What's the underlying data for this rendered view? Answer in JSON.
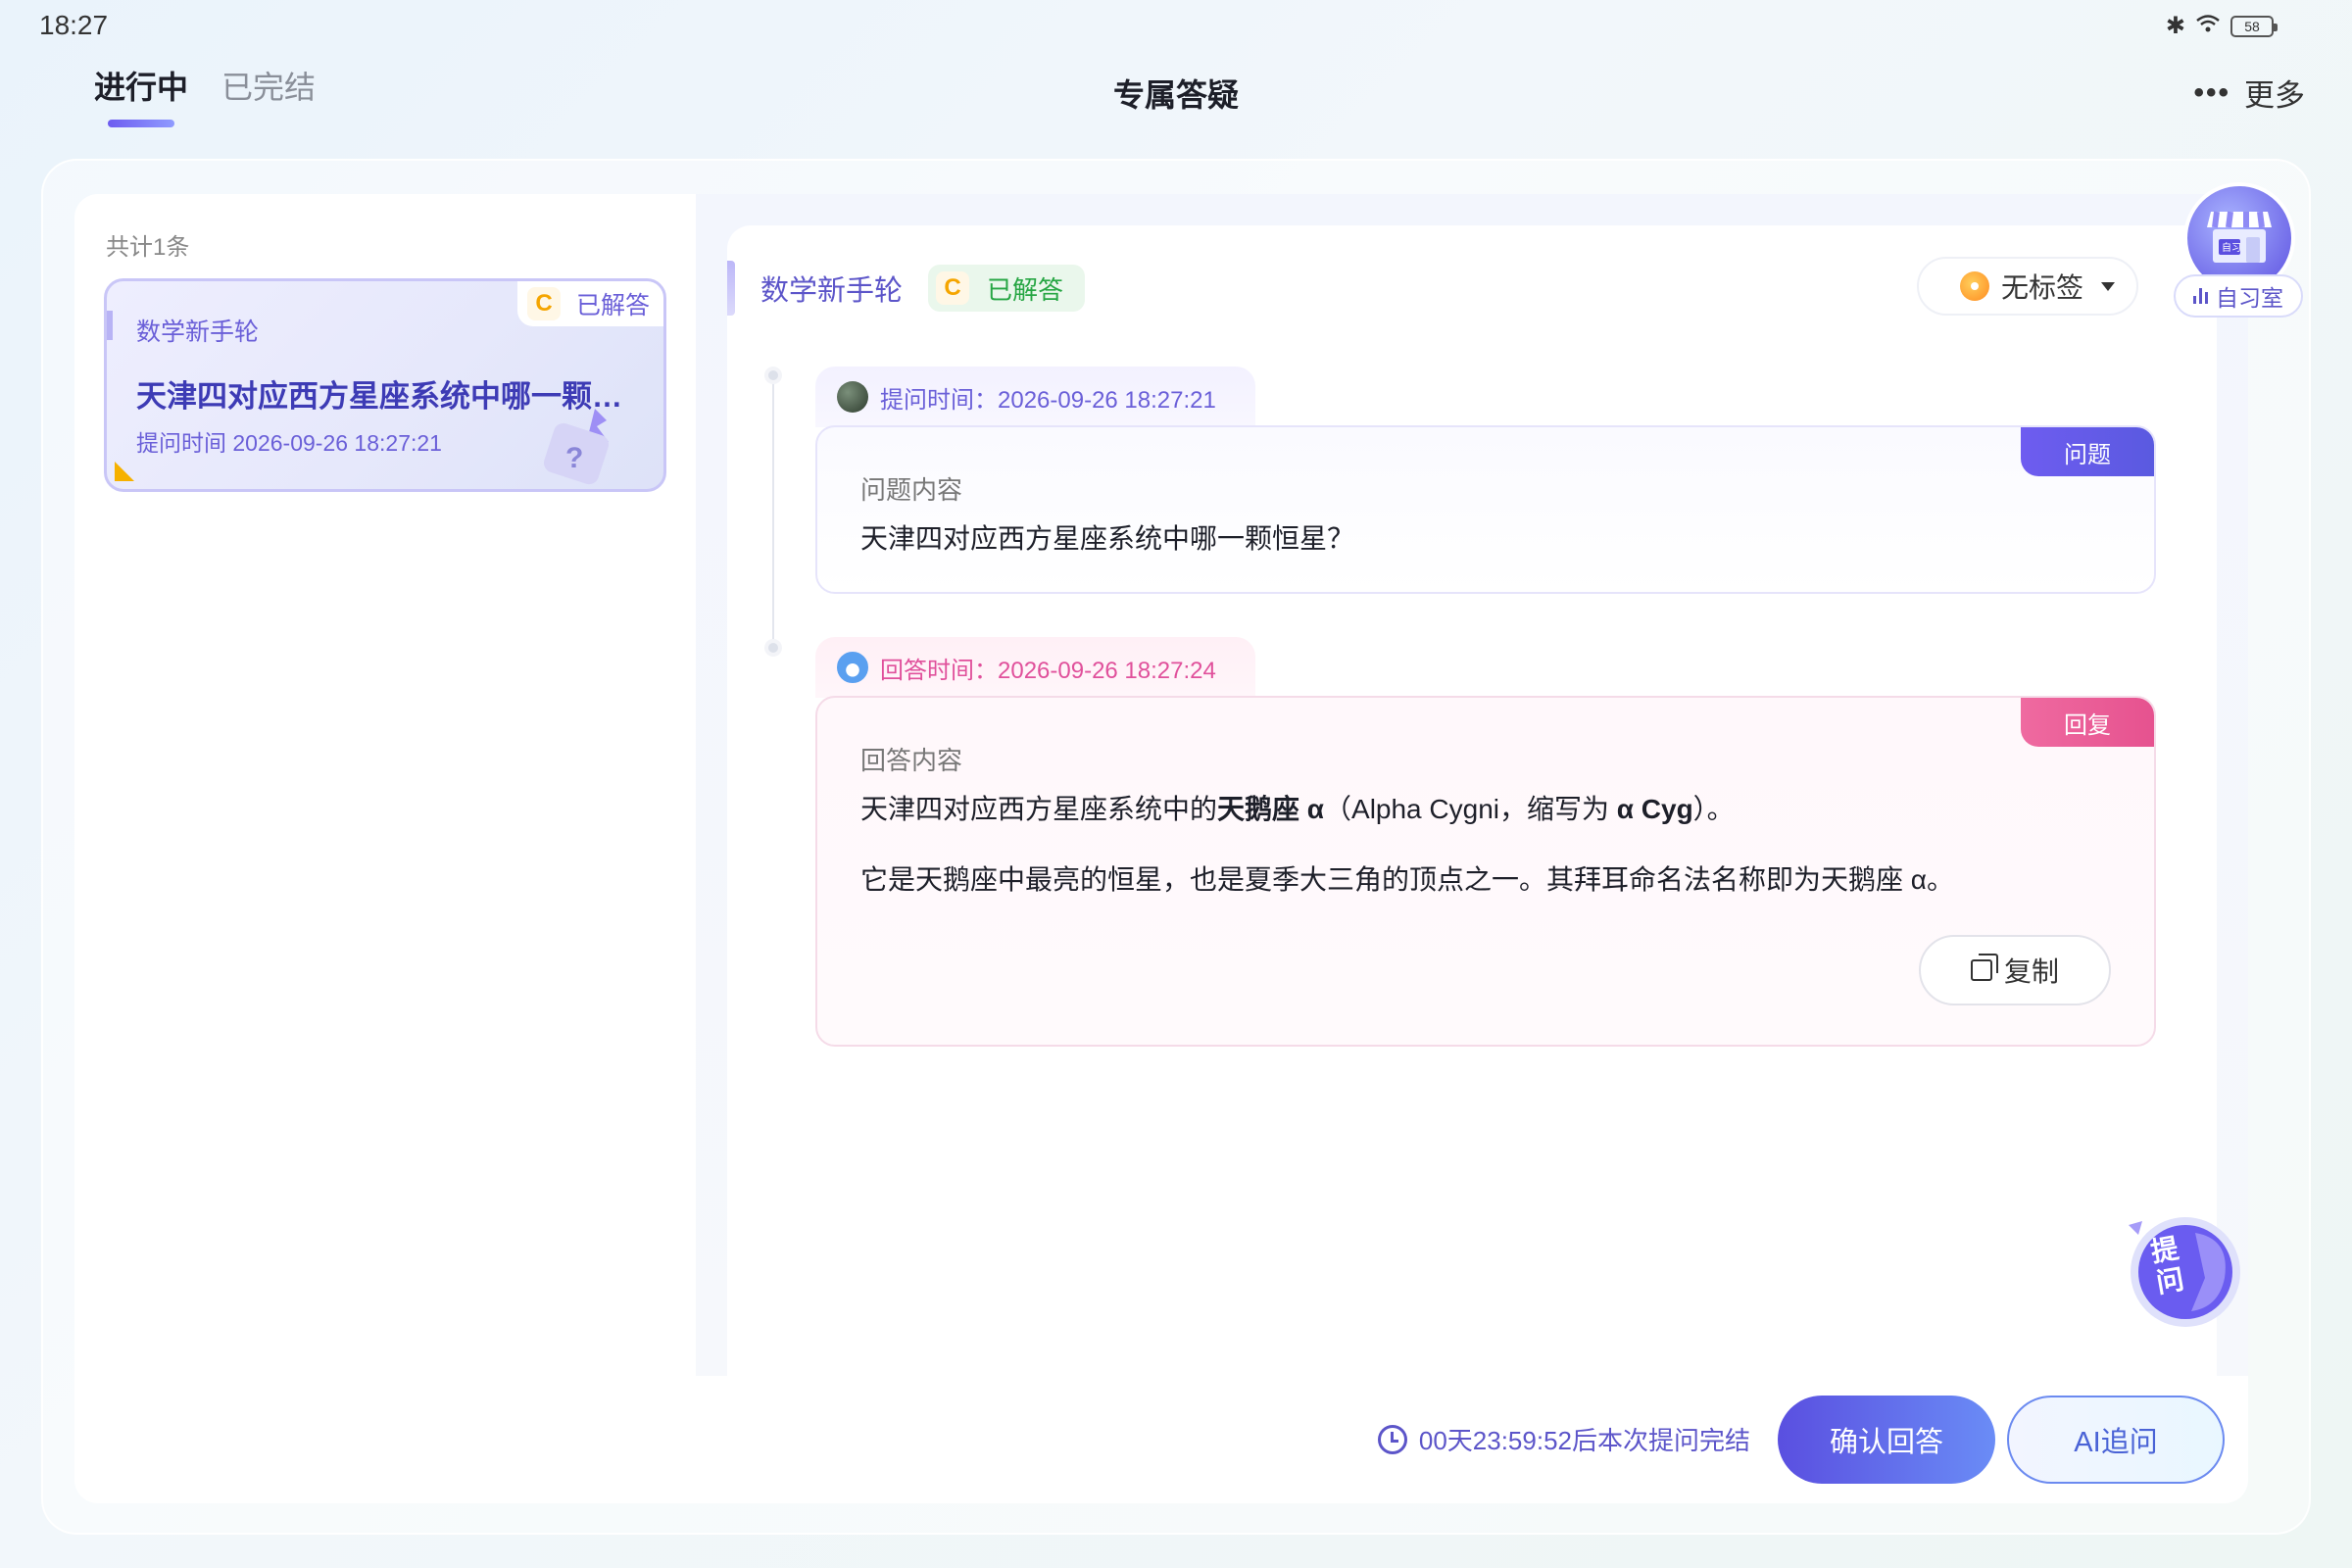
{
  "status_bar": {
    "time": "18:27",
    "battery": "58"
  },
  "header": {
    "tabs": [
      {
        "label": "进行中",
        "active": true
      },
      {
        "label": "已完结",
        "active": false
      }
    ],
    "title": "专属答疑",
    "more_label": "更多"
  },
  "list": {
    "count": "共计1条",
    "items": [
      {
        "subject": "数学新手轮",
        "badge_grade": "C",
        "badge_status": "已解答",
        "title": "天津四对应西方星座系统中哪一颗恒星？",
        "time": "提问时间 2026-09-26 18:27:21"
      }
    ]
  },
  "detail": {
    "subject": "数学新手轮",
    "grade": "C",
    "status": "已解答",
    "tag": "无标签",
    "question": {
      "time_label": "提问时间：2026-09-26 18:27:21",
      "badge": "问题",
      "heading": "问题内容",
      "content": "天津四对应西方星座系统中哪一颗恒星？"
    },
    "answer": {
      "time_label": "回答时间：2026-09-26 18:27:24",
      "badge": "回复",
      "heading": "回答内容",
      "line1_prefix": "天津四对应西方星座系统中的",
      "line1_bold1": "天鹅座 α",
      "line1_mid": "（Alpha Cygni，缩写为 ",
      "line1_bold2": "α Cyg",
      "line1_suffix": "）。",
      "line2": "它是天鹅座中最亮的恒星，也是夏季大三角的顶点之一。其拜耳命名法名称即为天鹅座 α。",
      "copy_label": "复制"
    }
  },
  "study_room": {
    "label": "自习室",
    "sign_text": "自习"
  },
  "ask_button": {
    "label": "提问"
  },
  "footer": {
    "countdown": "00天23:59:52后本次提问完结",
    "confirm_label": "确认回答",
    "ai_label": "AI追问"
  },
  "colors": {
    "primary": "#5c55c9",
    "answer_pink": "#e6528f",
    "solved_green": "#27a644",
    "grade_orange": "#f5a500"
  }
}
